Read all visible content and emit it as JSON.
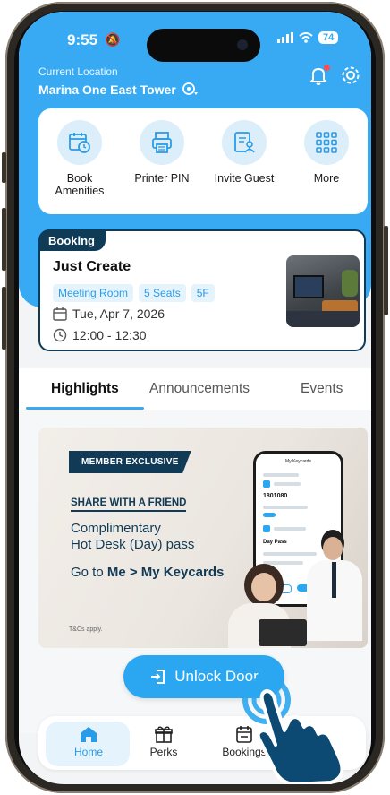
{
  "status": {
    "time": "9:55",
    "battery": "74"
  },
  "location": {
    "label": "Current Location",
    "name": "Marina One East Tower"
  },
  "quick_actions": [
    {
      "label": "Book Amenities",
      "icon": "calendar-clock-icon"
    },
    {
      "label": "Printer PIN",
      "icon": "printer-icon"
    },
    {
      "label": "Invite Guest",
      "icon": "invite-guest-icon"
    },
    {
      "label": "More",
      "icon": "grid-icon"
    }
  ],
  "booking": {
    "tag": "Booking",
    "title": "Just Create",
    "chips": [
      "Meeting Room",
      "5 Seats",
      "5F"
    ],
    "date": "Tue, Apr 7, 2026",
    "time": "12:00 - 12:30"
  },
  "tabs": [
    "Highlights",
    "Announcements",
    "Events"
  ],
  "promo": {
    "badge": "MEMBER EXCLUSIVE",
    "heading": "SHARE WITH A FRIEND",
    "line1": "Complimentary",
    "line2": "Hot Desk (Day) pass",
    "go_prefix": "Go to ",
    "go_path": "Me > My Keycards",
    "tc": "T&Cs apply.",
    "phone_title": "My Keycards",
    "phone_code": "1801080",
    "phone_pass": "Day Pass"
  },
  "unlock_label": "Unlock Door",
  "nav": [
    {
      "label": "Home",
      "icon": "home-icon"
    },
    {
      "label": "Perks",
      "icon": "gift-icon"
    },
    {
      "label": "Bookings",
      "icon": "calendar-icon"
    }
  ],
  "colors": {
    "brand": "#38aaf4",
    "navy": "#103a55",
    "chip_bg": "#e5f3fd"
  }
}
